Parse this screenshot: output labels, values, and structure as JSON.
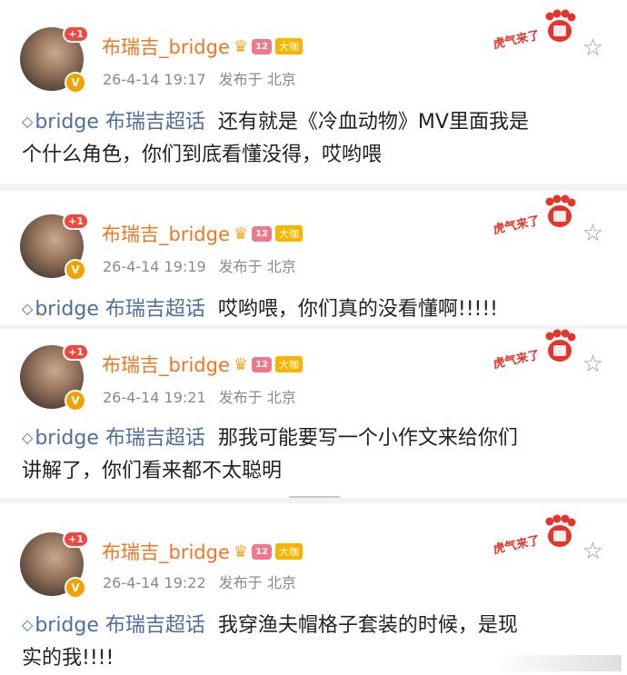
{
  "colors": {
    "username": "#f07722",
    "topic": "#4c6fa0",
    "meta": "#8a8a8a",
    "separator": "#f2f2f2"
  },
  "sticker_label": "虎气来了",
  "avatar_badge": "+1",
  "vip_badge": "V",
  "level_badge": "12",
  "dacai_badge": "大咖",
  "posts": [
    {
      "username": "布瑞吉_bridge",
      "time": "26-4-14 19:17",
      "source": "发布于 北京",
      "topic": "bridge 布瑞吉超话",
      "text_line1": "还有就是《冷血动物》MV里面我是",
      "text_line2": "个什么角色，你们到底看懂没得，哎哟喂"
    },
    {
      "username": "布瑞吉_bridge",
      "time": "26-4-14 19:19",
      "source": "发布于 北京",
      "topic": "bridge 布瑞吉超话",
      "text_line1": "哎哟喂，你们真的没看懂啊!!!!!",
      "text_line2": ""
    },
    {
      "username": "布瑞吉_bridge",
      "time": "26-4-14 19:21",
      "source": "发布于 北京",
      "topic": "bridge 布瑞吉超话",
      "text_line1": "那我可能要写一个小作文来给你们",
      "text_line2": "讲解了，你们看来都不太聪明"
    },
    {
      "username": "布瑞吉_bridge",
      "time": "26-4-14 19:22",
      "source": "发布于 北京",
      "topic": "bridge 布瑞吉超话",
      "text_line1": "我穿渔夫帽格子套装的时候，是现",
      "text_line2": "实的我!!!!"
    }
  ]
}
